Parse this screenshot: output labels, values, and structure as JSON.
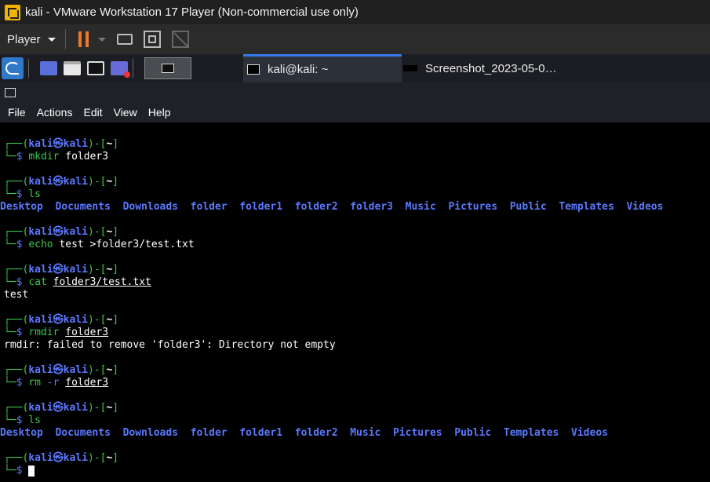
{
  "window": {
    "title": "kali - VMware Workstation 17 Player (Non-commercial use only)"
  },
  "toolbar": {
    "player_label": "Player"
  },
  "taskbar": {
    "tasks": [
      {
        "label": "kali@kali: ~"
      },
      {
        "label": "Screenshot_2023-05-0…"
      }
    ]
  },
  "term_menu": {
    "file": "File",
    "actions": "Actions",
    "edit": "Edit",
    "view": "View",
    "help": "Help"
  },
  "prompt": {
    "user": "kali",
    "host": "kali",
    "path": "~",
    "sep": "㉿"
  },
  "commands": [
    {
      "cmd": "mkdir",
      "args": "folder3"
    },
    {
      "cmd": "ls",
      "args": ""
    },
    {
      "cmd": "echo",
      "args": "test >folder3/test.txt"
    },
    {
      "cmd": "cat",
      "args": "folder3/test.txt"
    },
    {
      "cmd": "rmdir",
      "args": "folder3"
    },
    {
      "cmd": "rm",
      "flag": "-r",
      "args": "folder3"
    },
    {
      "cmd": "ls",
      "args": ""
    }
  ],
  "outputs": {
    "ls1": [
      "Desktop",
      "Documents",
      "Downloads",
      "folder",
      "folder1",
      "folder2",
      "folder3",
      "Music",
      "Pictures",
      "Public",
      "Templates",
      "Videos"
    ],
    "cat": "test",
    "rmdir_error": "rmdir: failed to remove 'folder3': Directory not empty",
    "ls2": [
      "Desktop",
      "Documents",
      "Downloads",
      "folder",
      "folder1",
      "folder2",
      "Music",
      "Pictures",
      "Public",
      "Templates",
      "Videos"
    ]
  },
  "colors": {
    "prompt_green": "#3ac74b",
    "prompt_blue": "#5a79ff",
    "accent_orange": "#f07826",
    "active_task": "#367bf0"
  },
  "icons": [
    "vmware-logo-icon",
    "pause-icon",
    "network-icon",
    "fullscreen-icon",
    "unity-icon",
    "kali-menu-icon",
    "terminal-icon"
  ]
}
